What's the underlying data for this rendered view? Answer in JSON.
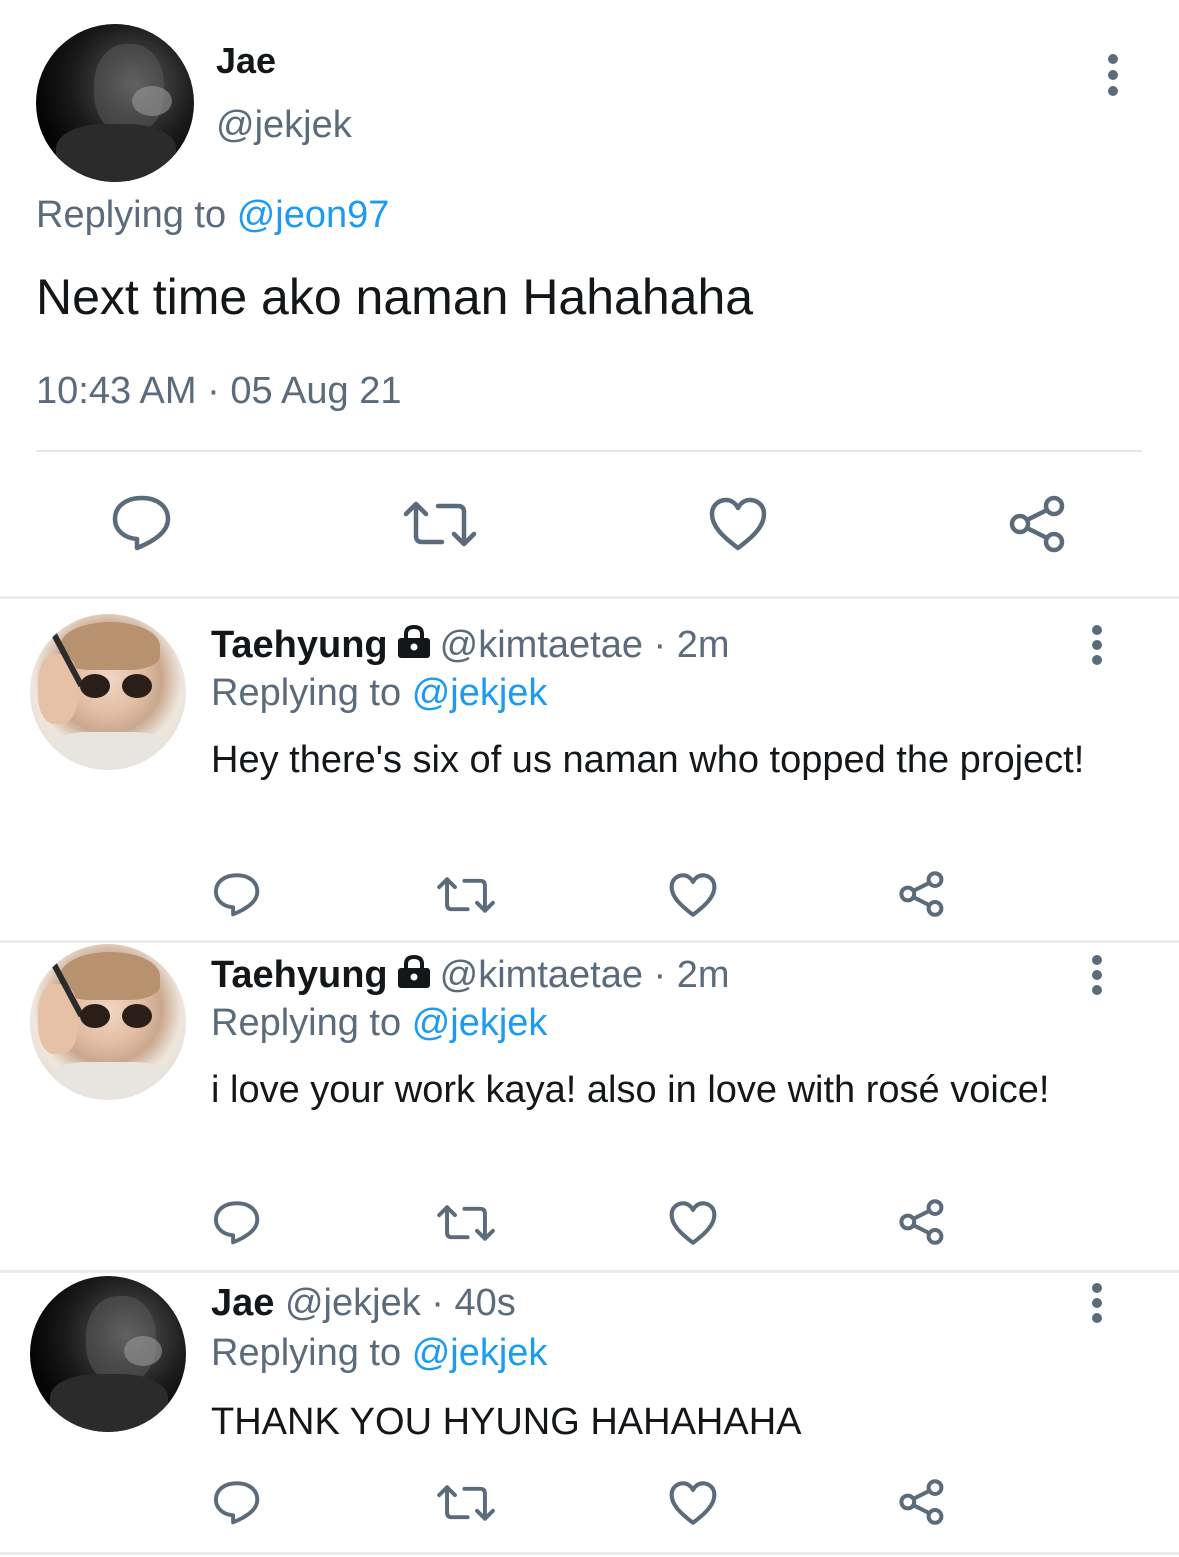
{
  "main_tweet": {
    "author_name": "Jae",
    "author_handle": "@jekjek",
    "replying_label": "Replying to",
    "replying_to": "@jeon97",
    "text": "Next time ako naman Hahahaha",
    "timestamp": "10:43 AM · 05 Aug 21"
  },
  "replies": [
    {
      "author_name": "Taehyung",
      "author_handle": "@kimtaetae",
      "time": "· 2m",
      "replying_label": "Replying to",
      "replying_to": "@jekjek",
      "text": "Hey there's six of us naman who topped the project!",
      "protected": true
    },
    {
      "author_name": "Taehyung",
      "author_handle": "@kimtaetae",
      "time": "· 2m",
      "replying_label": "Replying to",
      "replying_to": "@jekjek",
      "text": "i love your work kaya! also in love with rosé voice!",
      "protected": true
    },
    {
      "author_name": "Jae",
      "author_handle": "@jekjek",
      "time": "· 40s",
      "replying_label": "Replying to",
      "replying_to": "@jekjek",
      "text": "THANK YOU HYUNG HAHAHAHA",
      "protected": false
    }
  ],
  "icons": [
    "reply-icon",
    "retweet-icon",
    "like-icon",
    "share-icon",
    "more-options-icon",
    "lock-icon"
  ],
  "colors": {
    "text": "#14171a",
    "secondary": "#5b6b7b",
    "link": "#1d9bf0",
    "icon": "#5b6b7b",
    "divider": "#e6ecf0"
  }
}
